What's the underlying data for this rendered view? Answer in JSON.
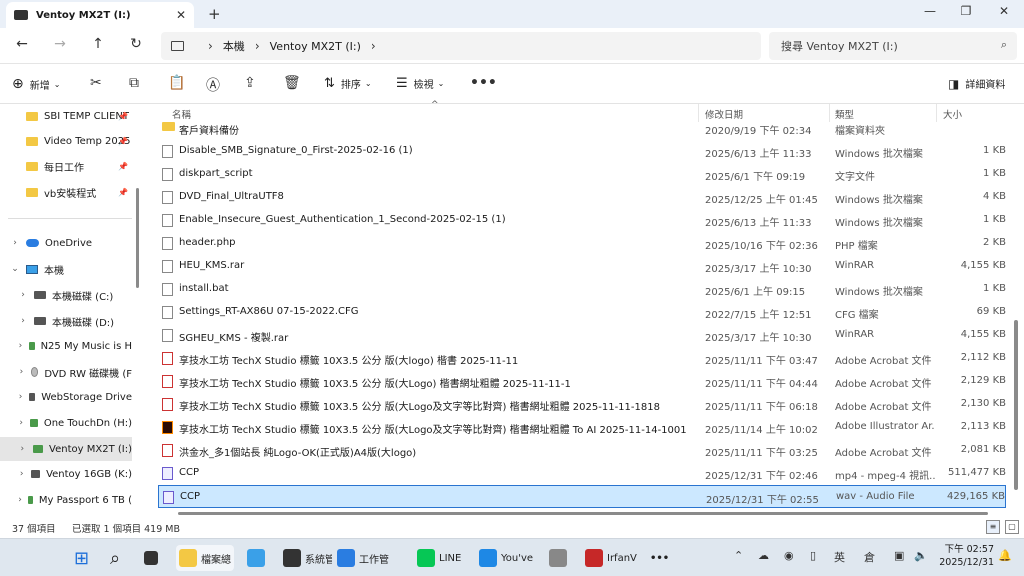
{
  "window": {
    "tab_title": "Ventoy MX2T (I:)"
  },
  "address": {
    "segments": [
      "本機",
      "Ventoy MX2T (I:)"
    ],
    "search_placeholder": "搜尋 Ventoy MX2T (I:)"
  },
  "commands": {
    "new": "新增",
    "sort": "排序",
    "view": "檢視",
    "details": "詳細資料"
  },
  "sidebar": [
    {
      "label": "SBI TEMP CLIENT",
      "icon": "folder-icon",
      "pinned": true
    },
    {
      "label": "Video Temp 2025",
      "icon": "folder-icon",
      "pinned": true
    },
    {
      "label": "每日工作",
      "icon": "folder-icon",
      "pinned": true
    },
    {
      "label": "vb安裝程式",
      "icon": "folder-icon",
      "pinned": true
    },
    {
      "label": "OneDrive",
      "icon": "cloud-icon"
    },
    {
      "label": "本機",
      "icon": "pc-icon"
    },
    {
      "label": "本機磁碟 (C:)",
      "icon": "drive-icon"
    },
    {
      "label": "本機磁碟 (D:)",
      "icon": "drive-icon"
    },
    {
      "label": "N25 My Music is H",
      "icon": "usb-drive-icon"
    },
    {
      "label": "DVD RW 磁碟機 (F",
      "icon": "dvd-icon"
    },
    {
      "label": "WebStorage Drive",
      "icon": "drive-icon"
    },
    {
      "label": "One TouchDn (H:)",
      "icon": "usb-drive-icon"
    },
    {
      "label": "Ventoy MX2T (I:)",
      "icon": "usb-drive-icon"
    },
    {
      "label": "Ventoy 16GB (K:)",
      "icon": "drive-icon"
    },
    {
      "label": "My Passport 6 TB (",
      "icon": "usb-drive-icon"
    }
  ],
  "columns": {
    "name": "名稱",
    "date": "修改日期",
    "type": "類型",
    "size": "大小"
  },
  "files": [
    {
      "name": "客戶資料備份",
      "date": "2020/9/19 下午 02:34",
      "type": "檔案資料夾",
      "size": "",
      "icon": "folder"
    },
    {
      "name": "Disable_SMB_Signature_0_First-2025-02-16 (1)",
      "date": "2025/6/13 上午 11:33",
      "type": "Windows 批次檔案",
      "size": "1 KB",
      "icon": "bat"
    },
    {
      "name": "diskpart_script",
      "date": "2025/6/1 下午 09:19",
      "type": "文字文件",
      "size": "1 KB",
      "icon": "doc"
    },
    {
      "name": "DVD_Final_UltraUTF8",
      "date": "2025/12/25 上午 01:45",
      "type": "Windows 批次檔案",
      "size": "4 KB",
      "icon": "bat"
    },
    {
      "name": "Enable_Insecure_Guest_Authentication_1_Second-2025-02-15 (1)",
      "date": "2025/6/13 上午 11:33",
      "type": "Windows 批次檔案",
      "size": "1 KB",
      "icon": "bat"
    },
    {
      "name": "header.php",
      "date": "2025/10/16 下午 02:36",
      "type": "PHP 檔案",
      "size": "2 KB",
      "icon": "doc"
    },
    {
      "name": "HEU_KMS.rar",
      "date": "2025/3/17 上午 10:30",
      "type": "WinRAR",
      "size": "4,155 KB",
      "icon": "doc"
    },
    {
      "name": "install.bat",
      "date": "2025/6/1 上午 09:15",
      "type": "Windows 批次檔案",
      "size": "1 KB",
      "icon": "bat"
    },
    {
      "name": "Settings_RT-AX86U 07-15-2022.CFG",
      "date": "2022/7/15 上午 12:51",
      "type": "CFG 檔案",
      "size": "69 KB",
      "icon": "doc"
    },
    {
      "name": "SGHEU_KMS - 複製.rar",
      "date": "2025/3/17 上午 10:30",
      "type": "WinRAR",
      "size": "4,155 KB",
      "icon": "doc"
    },
    {
      "name": "享技水工坊 TechX Studio 標籤 10X3.5 公分 版(大logo) 楷書 2025-11-11",
      "date": "2025/11/11 下午 03:47",
      "type": "Adobe Acrobat 文件",
      "size": "2,112 KB",
      "icon": "pdf"
    },
    {
      "name": "享技水工坊 TechX Studio 標籤 10X3.5 公分 版(大Logo) 楷書網址粗體 2025-11-11-1",
      "date": "2025/11/11 下午 04:44",
      "type": "Adobe Acrobat 文件",
      "size": "2,129 KB",
      "icon": "pdf"
    },
    {
      "name": "享技水工坊 TechX Studio 標籤 10X3.5 公分 版(大Logo及文字等比對齊) 楷書網址粗體 2025-11-11-1818",
      "date": "2025/11/11 下午 06:18",
      "type": "Adobe Acrobat 文件",
      "size": "2,130 KB",
      "icon": "pdf"
    },
    {
      "name": "享技水工坊 TechX Studio 標籤 10X3.5 公分 版(大Logo及文字等比對齊) 楷書網址粗體 To AI 2025-11-14-1001",
      "date": "2025/11/14 上午 10:02",
      "type": "Adobe Illustrator Ar...",
      "size": "2,113 KB",
      "icon": "ai"
    },
    {
      "name": "洪金水_多1個站長 純Logo-OK(正式版)A4版(大logo)",
      "date": "2025/11/11 下午 03:25",
      "type": "Adobe Acrobat 文件",
      "size": "2,081 KB",
      "icon": "pdf"
    },
    {
      "name": "CCP",
      "date": "2025/12/31 下午 02:46",
      "type": "mp4 - mpeg-4 視訊...",
      "size": "511,477 KB",
      "icon": "media"
    },
    {
      "name": "CCP",
      "date": "2025/12/31 下午 02:55",
      "type": "wav - Audio File",
      "size": "429,165 KB",
      "icon": "media",
      "selected": true
    }
  ],
  "status": {
    "count": "37 個項目",
    "selected": "已選取 1 個項目 419 MB"
  },
  "taskbar": {
    "apps": [
      {
        "label": "檔案總",
        "color": "#f3c844"
      },
      {
        "label": "",
        "color": "#3aa0e8"
      },
      {
        "label": "系統管",
        "color": "#333333"
      },
      {
        "label": "工作管",
        "color": "#2a7de1"
      },
      {
        "label": "LINE",
        "color": "#06c755"
      },
      {
        "label": "You've",
        "color": "#1e88e5"
      },
      {
        "label": "",
        "color": "#888888"
      },
      {
        "label": "IrfanV",
        "color": "#c62828"
      }
    ],
    "ime": "英",
    "ime2": "倉",
    "time": "下午 02:57",
    "date": "2025/12/31"
  }
}
